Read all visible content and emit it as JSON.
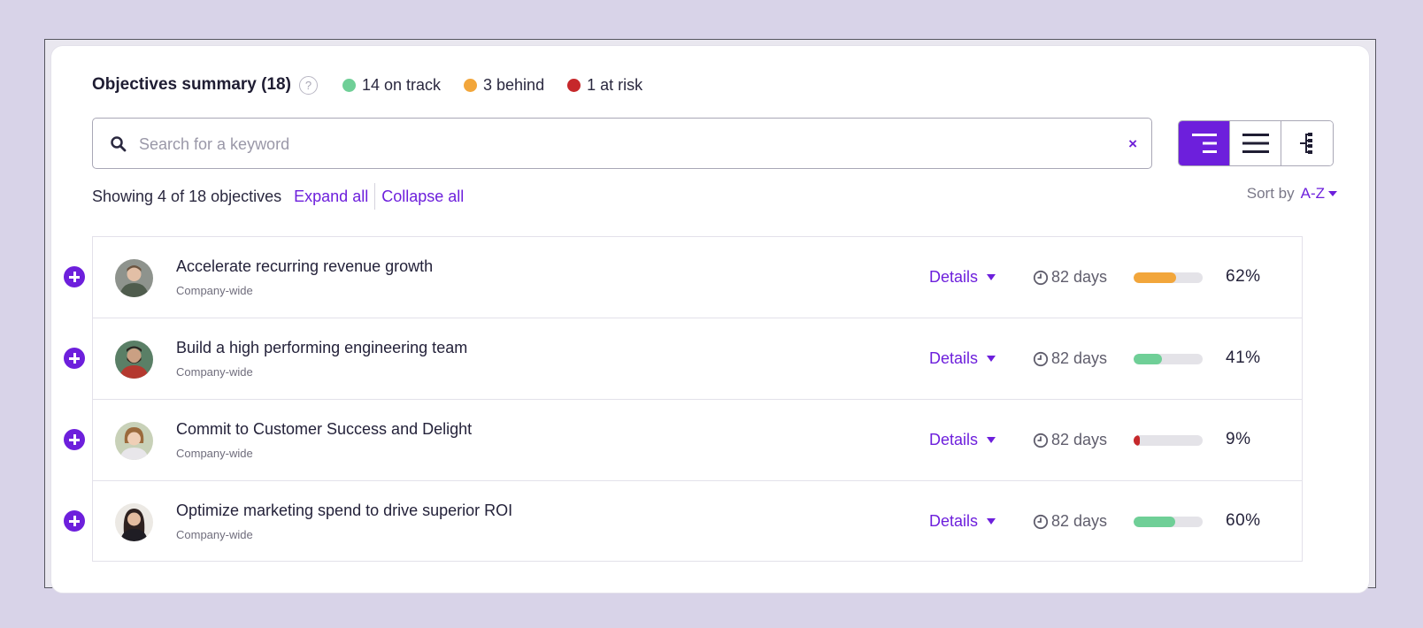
{
  "summary": {
    "title": "Objectives summary (18)",
    "help_icon": "?",
    "statuses": [
      {
        "label": "14 on track",
        "color": "#6fcf97"
      },
      {
        "label": "3 behind",
        "color": "#f2a63b"
      },
      {
        "label": "1 at risk",
        "color": "#c6282b"
      }
    ]
  },
  "search": {
    "placeholder": "Search for a keyword",
    "value": "",
    "clear_icon": "×"
  },
  "views": [
    {
      "name": "tree-view-icon",
      "active": true
    },
    {
      "name": "list-view-icon",
      "active": false
    },
    {
      "name": "hierarchy-view-icon",
      "active": false
    }
  ],
  "toolbar": {
    "showing": "Showing 4 of 18 objectives",
    "expand_all": "Expand all",
    "collapse_all": "Collapse all",
    "sort_label": "Sort by",
    "sort_value": "A-Z"
  },
  "objectives": [
    {
      "title": "Accelerate recurring revenue growth",
      "scope": "Company-wide",
      "details": "Details",
      "due": "82 days",
      "progress": 62,
      "progress_label": "62%",
      "color": "#f2a63b",
      "avatar": "avatar-man-light"
    },
    {
      "title": "Build a high performing engineering team",
      "scope": "Company-wide",
      "details": "Details",
      "due": "82 days",
      "progress": 41,
      "progress_label": "41%",
      "color": "#6fcf97",
      "avatar": "avatar-man-beard"
    },
    {
      "title": "Commit to Customer Success and Delight",
      "scope": "Company-wide",
      "details": "Details",
      "due": "82 days",
      "progress": 9,
      "progress_label": "9%",
      "color": "#c6282b",
      "avatar": "avatar-woman-short-hair"
    },
    {
      "title": "Optimize marketing spend to drive superior ROI",
      "scope": "Company-wide",
      "details": "Details",
      "due": "82 days",
      "progress": 60,
      "progress_label": "60%",
      "color": "#6fcf97",
      "avatar": "avatar-woman-dark-hair"
    }
  ]
}
